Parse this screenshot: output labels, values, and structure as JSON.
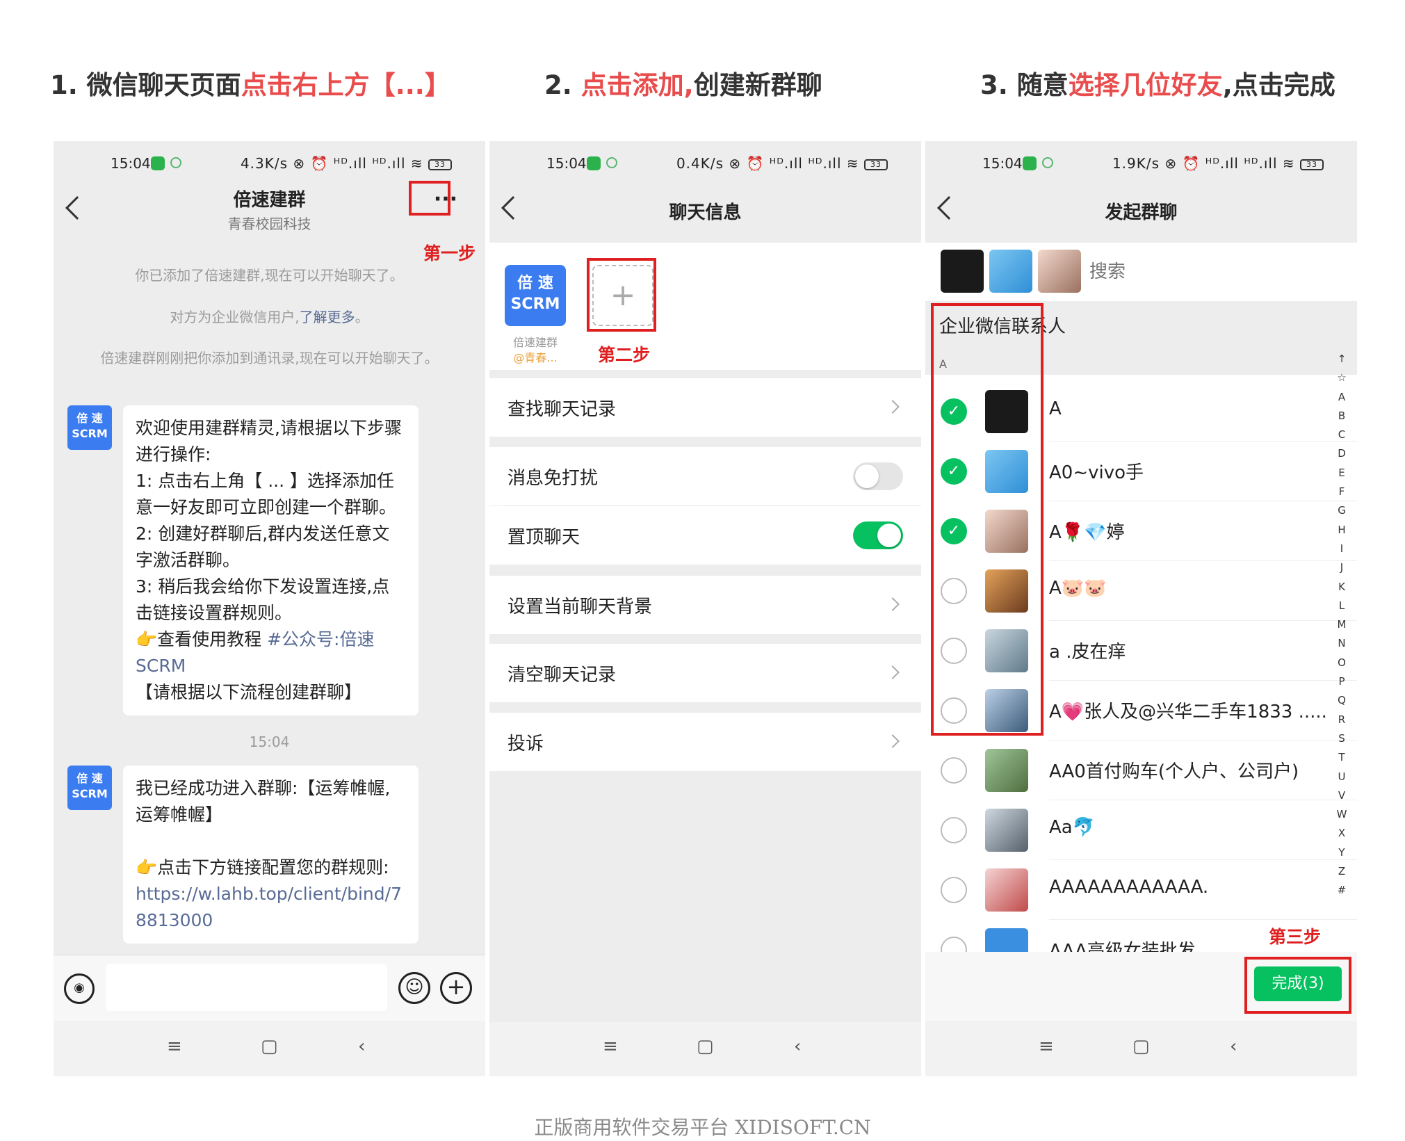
{
  "headings": {
    "h1": {
      "pre": "1. 微信聊天页面",
      "hl": "点击右上方【...】",
      "post": ""
    },
    "h2": {
      "pre": "2. ",
      "hl": "点击添加,",
      "post": "创建新群聊"
    },
    "h3": {
      "pre": "3. 随意",
      "hl": "选择几位好友",
      "post": ",点击完成"
    }
  },
  "colors": {
    "accent_red": "#e84c4c",
    "wechat_green": "#07c160",
    "scrm_blue": "#3b7cf0",
    "link_blue": "#576b95"
  },
  "panel1": {
    "status": {
      "time": "15:04",
      "right": "4.3K/s ⊗ ⏰ ᴴᴰ.ıll ᴴᴰ.ıll ≋",
      "battery": "33"
    },
    "title": "倍速建群",
    "subtitle": "青春校园科技",
    "more_label": "···",
    "step_mark": "第一步",
    "sys1": "你已添加了倍速建群,现在可以开始聊天了。",
    "sys2_text": "对方为企业微信用户,",
    "sys2_link": "了解更多",
    "sys2_end": "。",
    "sys3": "倍速建群刚刚把你添加到通讯录,现在可以开始聊天了。",
    "avatar_text": "倍 速\nSCRM",
    "msg1": {
      "l1": "欢迎使用建群精灵,请根据以下步骤进行操作:",
      "l2": "1: 点击右上角【 ... 】选择添加任意一好友即可立即创建一个群聊。",
      "l3": "2: 创建好群聊后,群内发送任意文字激活群聊。",
      "l4": "3: 稍后我会给你下发设置连接,点击链接设置群规则。",
      "l5_pre": "👉查看使用教程 ",
      "l5_link": "#公众号:倍速SCRM",
      "l6": "【请根据以下流程创建群聊】"
    },
    "time_sep": "15:04",
    "msg2": {
      "l1": "我已经成功进入群聊:【运筹帷幄,运筹帷幄】",
      "l2": "👉点击下方链接配置您的群规则:",
      "link": "https://w.lahb.top/client/bind/78813000"
    },
    "icons": {
      "voice": "voice-icon",
      "emoji": "emoji-icon",
      "plus": "plus-icon"
    }
  },
  "panel2": {
    "status": {
      "time": "15:04",
      "right": "0.4K/s ⊗ ⏰ ᴴᴰ.ıll ᴴᴰ.ıll ≋",
      "battery": "33"
    },
    "title": "聊天信息",
    "member_avatar_text": "倍 速\nSCRM",
    "member_name": "倍速建群",
    "member_sub": "@青春...",
    "add_symbol": "+",
    "step_mark": "第二步",
    "items": {
      "search": "查找聊天记录",
      "mute": "消息免打扰",
      "pin": "置顶聊天",
      "bg": "设置当前聊天背景",
      "clear": "清空聊天记录",
      "report": "投诉"
    },
    "mute_on": false,
    "pin_on": true
  },
  "panel3": {
    "status": {
      "time": "15:04",
      "right": "1.9K/s ⊗ ⏰ ᴴᴰ.ıll ᴴᴰ.ıll ≋",
      "battery": "33"
    },
    "title": "发起群聊",
    "search_placeholder": "搜索",
    "section": "企业微信联系人",
    "letter": "A",
    "contacts": [
      {
        "name": "A",
        "checked": true
      },
      {
        "name": "A0~vivo手",
        "checked": true
      },
      {
        "name": "A🌹💎婷",
        "checked": true
      },
      {
        "name": "A🐷🐷",
        "checked": false
      },
      {
        "name": "a .皮在痒",
        "checked": false
      },
      {
        "name": "A💗张人及@兴华二手车1833 .....",
        "checked": false
      },
      {
        "name": "AA0首付购车(个人户、公司户)",
        "checked": false
      },
      {
        "name": "Aa🐬",
        "checked": false
      },
      {
        "name": "AAAAAAAAAAAA.",
        "checked": false
      },
      {
        "name": "AAA高级女装批发",
        "checked": false
      }
    ],
    "alphabet": [
      "↑",
      "☆",
      "A",
      "B",
      "C",
      "D",
      "E",
      "F",
      "G",
      "H",
      "I",
      "J",
      "K",
      "L",
      "M",
      "N",
      "O",
      "P",
      "Q",
      "R",
      "S",
      "T",
      "U",
      "V",
      "W",
      "X",
      "Y",
      "Z",
      "#"
    ],
    "step_mark": "第三步",
    "done_label": "完成(3)"
  },
  "sysnav": {
    "menu": "≡",
    "home": "▢",
    "back": "‹"
  },
  "footer": "正版商用软件交易平台 XIDISOFT.CN"
}
